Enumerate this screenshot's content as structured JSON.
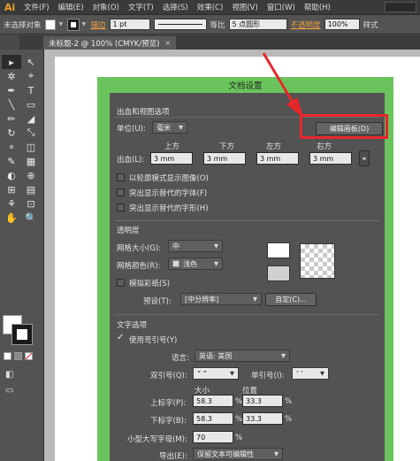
{
  "menubar": {
    "logo": "Ai",
    "items": [
      "文件(F)",
      "编辑(E)",
      "对象(O)",
      "文字(T)",
      "选择(S)",
      "效果(C)",
      "视图(V)",
      "窗口(W)",
      "帮助(H)"
    ]
  },
  "controlbar": {
    "selection": "未选择对象",
    "stroke_label": "描边",
    "stroke_weight": "1 pt",
    "profile": "等比",
    "brush": "5 点圆形",
    "opacity_label": "不透明度",
    "opacity_value": "100%",
    "style_label": "样式"
  },
  "document_tab": {
    "title": "未标题-2 @ 100% (CMYK/预览)",
    "close": "×"
  },
  "tools": [
    "▸",
    "↖",
    "✲",
    "⌖",
    "✒",
    "T",
    "╲",
    "▭",
    "✏",
    "◢",
    "↻",
    "⤡",
    "⚬",
    "◫",
    "✎",
    "▦",
    "◐",
    "⊕",
    "⊞",
    "▤",
    "⚘",
    "⊡",
    "✋",
    "🔍"
  ],
  "dialog": {
    "title": "文档设置",
    "bleed_section": "出血和视图选项",
    "unit_label": "单位(U):",
    "unit_value": "毫米",
    "edit_artboards_button": "编辑画板(D)",
    "bleed_label": "出血(L):",
    "top_label": "上方",
    "bottom_label": "下方",
    "left_label": "左方",
    "right_label": "右方",
    "top_value": "3 mm",
    "bottom_value": "3 mm",
    "left_value": "3 mm",
    "right_value": "3 mm",
    "outline_checkbox": "以轮廓模式显示图像(O)",
    "substituted_fonts_checkbox": "突出显示替代的字体(F)",
    "substituted_glyphs_checkbox": "突出显示替代的字形(H)",
    "transparency_section": "透明度",
    "grid_size_label": "网格大小(G):",
    "grid_size_value": "中",
    "grid_colors_label": "网格颜色(R):",
    "grid_colors_value": "浅色",
    "simulate_paper_checkbox": "模拟彩纸(S)",
    "preset_label": "预设(T):",
    "preset_value": "[中分辨率]",
    "custom_button": "自定(C)...",
    "type_section": "文字选项",
    "typographers_quotes_checkbox": "使用弯引号(Y)",
    "language_label": "语言:",
    "language_value": "英语: 美国",
    "double_quotes_label": "双引号(Q):",
    "double_quotes_value": "“ ”",
    "single_quotes_label": "单引号(I):",
    "single_quotes_value": "‘ ’",
    "size_header": "大小",
    "position_header": "位置",
    "superscript_label": "上标字(P):",
    "superscript_size": "58.3",
    "superscript_position": "33.3",
    "subscript_label": "下标字(B):",
    "subscript_size": "58.3",
    "subscript_position": "33.3",
    "small_caps_label": "小型大写字母(M):",
    "small_caps_value": "70",
    "percent": "%",
    "export_label": "导出(E):",
    "export_value": "保留文本可编辑性"
  },
  "colors": {
    "dialog_header": "#6ac35d",
    "highlight": "#e8262a"
  }
}
